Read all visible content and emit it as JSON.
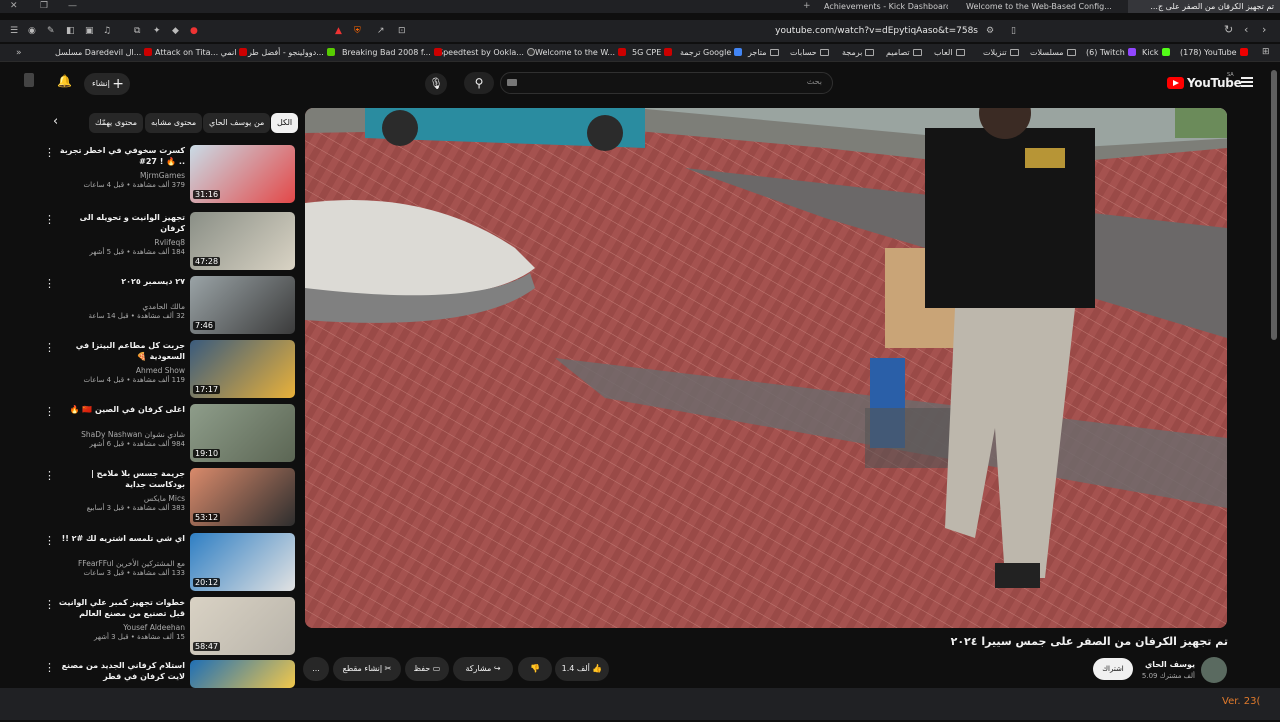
{
  "browser": {
    "tabs": [
      {
        "label": "Achievements - Kick Dashboard"
      },
      {
        "label": "Welcome to the Web-Based Config..."
      },
      {
        "label": "تم تجهيز الكرفان من الصفر على ج..."
      }
    ],
    "url": "youtube.com/watch?v=dEpytiqAaso&t=758s",
    "bookmarks": [
      "(178) YouTube",
      "Kick",
      "(6) Twitch",
      "مسلسلات",
      "تنزيلات",
      "العاب",
      "تصاميم",
      "برمجة",
      "حسابات",
      "متاجر",
      "ترجمة Google",
      "5G CPE",
      "Welcome to the W...",
      "Speedtest by Ookla...",
      "Breaking Bad 2008 f...",
      "دوولينجو - أفضل طر...",
      "Attack on Tita... انمي",
      "مسلسل Daredevil ال..."
    ]
  },
  "youtube": {
    "logo_text": "YouTube",
    "region": "SA",
    "search_placeholder": "بحث",
    "create_label": "إنشاء",
    "chips": [
      "الكل",
      "من يوسف الحاي",
      "محتوى مشابه",
      "محتوى يهمّك"
    ]
  },
  "recommendations": [
    {
      "title": "كسرت سخوفي في اخطر تجربة .. 🔥 ! 27#",
      "channel": "MjrmGames",
      "meta": "379 ألف مشاهدة • قبل 4 ساعات",
      "duration": "31:16",
      "colors": [
        "#c9dbe6",
        "#e34848"
      ]
    },
    {
      "title": "تجهيز الوانيت و تحويله الى كرفان",
      "channel": "Rvlifeq8",
      "meta": "184 ألف مشاهدة • قبل 5 أشهر",
      "duration": "47:28",
      "colors": [
        "#8a8f86",
        "#d9d3c4"
      ]
    },
    {
      "title": "٢٧ ديسمبر ٢٠٢٥",
      "channel": "مالك الحامدي",
      "meta": "32 ألف مشاهدة • قبل 14 ساعة",
      "duration": "7:46",
      "colors": [
        "#9aa3a6",
        "#3b3b3b"
      ]
    },
    {
      "title": "جربت كل مطاعم البيتزا في السعودية 🍕",
      "channel": "Ahmed Show",
      "meta": "119 ألف مشاهدة • قبل 4 ساعات",
      "duration": "17:17",
      "colors": [
        "#3a5b7d",
        "#e9b13a"
      ]
    },
    {
      "title": "اغلى كرفان في الصين 🇨🇳 🔥",
      "channel": "ShaDy Nashwan شادي نشوان",
      "meta": "984 ألف مشاهدة • قبل 6 أشهر",
      "duration": "19:10",
      "colors": [
        "#8e9d8a",
        "#5c6654"
      ]
    },
    {
      "title": "جريمة جسس بلا ملامح | بودكاست جداية",
      "channel": "مايكس Mics",
      "meta": "383 ألف مشاهدة • قبل 3 أسابيع",
      "duration": "53:12",
      "colors": [
        "#d98a6b",
        "#2e2e2e"
      ]
    },
    {
      "title": "اي شي تلمسه اشتريه لك #٢ !!",
      "channel": "FFearFFul مع المشتركين الأخرين",
      "meta": "133 ألف مشاهدة • قبل 3 ساعات",
      "duration": "20:12",
      "colors": [
        "#2f7fc4",
        "#e2e2e2"
      ]
    },
    {
      "title": "خطوات تجهيز كمبر علي الوانيت قبل تصنيع من مصنع العالم",
      "channel": "Yousef Aldeehan",
      "meta": "15 ألف مشاهدة • قبل 3 أشهر",
      "duration": "58:47",
      "colors": [
        "#d9d2c4",
        "#b9b4aa"
      ]
    },
    {
      "title": "استلام كرفاني الجديد من مصنع لايت كرفان في قطر",
      "channel": "",
      "meta": "",
      "duration": "",
      "colors": [
        "#1f6fb5",
        "#f2c84b"
      ]
    }
  ],
  "video": {
    "title": "تم تجهيز الكرفان من الصفر على جمس سييرا ٢٠٢٤",
    "channel": "يوسف الحاي",
    "subscribers": "5.09 ألف مشترك",
    "subscribe_label": "اشتراك",
    "like_count": "1.4 ألف",
    "share_label": "مشاركة",
    "save_label": "حفظ",
    "clip_label": "إنشاء مقطع",
    "more_label": "..."
  },
  "status": {
    "version": "Ver. 23("
  }
}
